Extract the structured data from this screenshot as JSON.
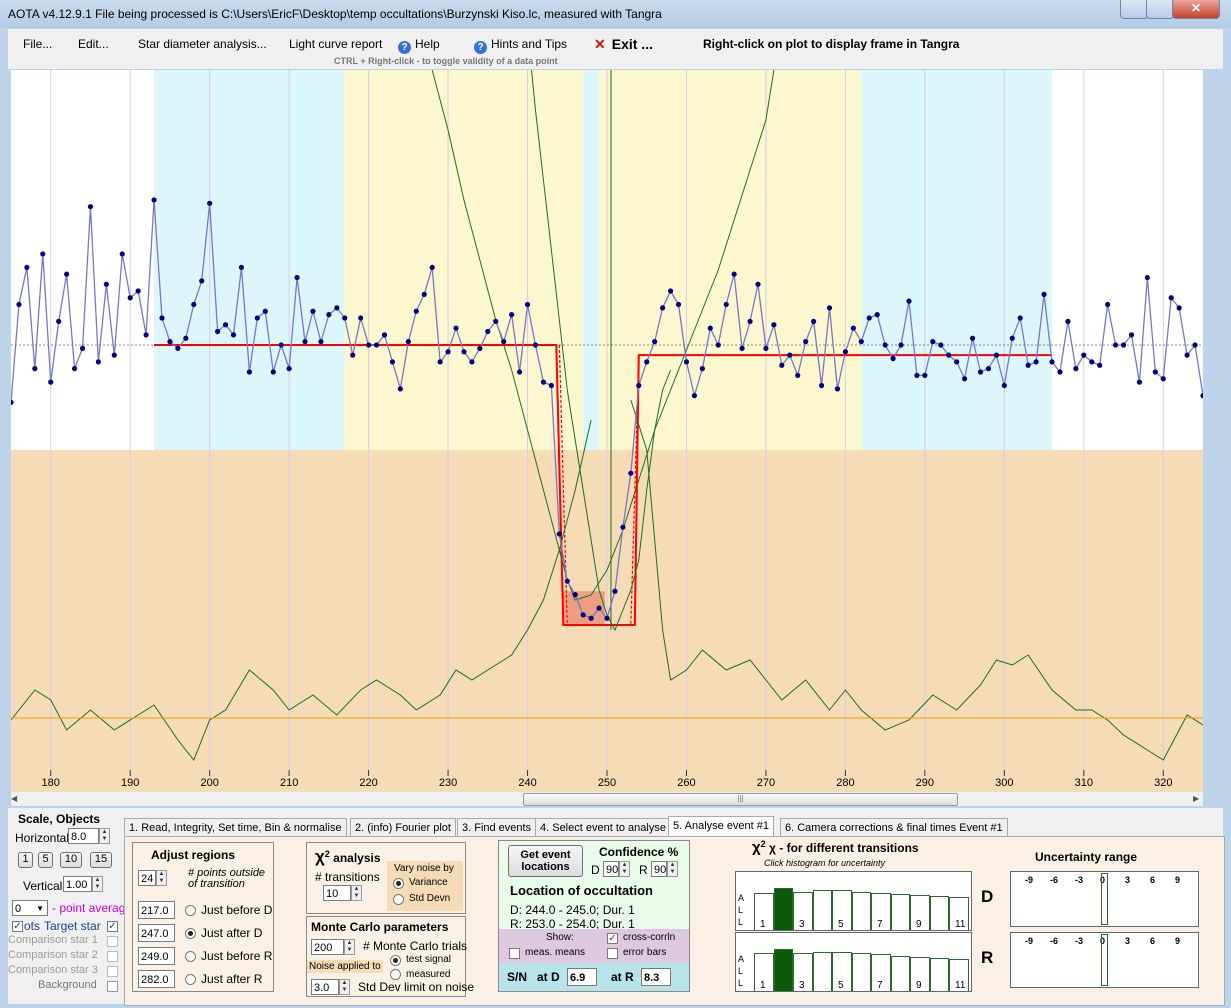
{
  "window": {
    "title": "AOTA v4.12.9.1    File being processed is C:\\Users\\EricF\\Desktop\\temp occultations\\Burzynski Kiso.lc, measured with Tangra"
  },
  "menu": {
    "file": "File...",
    "edit": "Edit...",
    "star_diam": "Star diameter analysis...",
    "light_curve": "Light curve report",
    "help": "Help",
    "hints": "Hints and Tips",
    "exit": "Exit ...",
    "right_click_note": "Right-click on plot to display frame in Tangra",
    "ctrl_note": "CTRL + Right-click  -  to toggle validity of a data point"
  },
  "chart_data": {
    "type": "line",
    "xlim": [
      175,
      325
    ],
    "x_ticks": [
      "180",
      "190",
      "200",
      "210",
      "220",
      "230",
      "240",
      "250",
      "260",
      "270",
      "280",
      "290",
      "300",
      "310",
      "320"
    ],
    "light_curve": {
      "x": [
        175,
        176,
        177,
        178,
        179,
        180,
        181,
        182,
        183,
        184,
        185,
        186,
        187,
        188,
        189,
        190,
        191,
        192,
        193,
        194,
        195,
        196,
        197,
        198,
        199,
        200,
        201,
        202,
        203,
        204,
        205,
        206,
        207,
        208,
        209,
        210,
        211,
        212,
        213,
        214,
        215,
        216,
        217,
        218,
        219,
        220,
        221,
        222,
        223,
        224,
        225,
        226,
        227,
        228,
        229,
        230,
        231,
        232,
        233,
        234,
        235,
        236,
        237,
        238,
        239,
        240,
        241,
        242,
        243,
        244,
        245,
        246,
        247,
        248,
        249,
        250,
        251,
        252,
        253,
        254,
        255,
        256,
        257,
        258,
        259,
        260,
        261,
        262,
        263,
        264,
        265,
        266,
        267,
        268,
        269,
        270,
        271,
        272,
        273,
        274,
        275,
        276,
        277,
        278,
        279,
        280,
        281,
        282,
        283,
        284,
        285,
        286,
        287,
        288,
        289,
        290,
        291,
        292,
        293,
        294,
        295,
        296,
        297,
        298,
        299,
        300,
        301,
        302,
        303,
        304,
        305,
        306,
        307,
        308,
        309,
        310,
        311,
        312,
        313,
        314,
        315,
        316,
        317,
        318,
        319,
        320,
        321,
        322,
        323,
        324,
        325
      ],
      "y": [
        0.96,
        1.25,
        1.36,
        1.06,
        1.4,
        1.02,
        1.2,
        1.34,
        1.06,
        1.12,
        1.54,
        1.08,
        1.31,
        1.1,
        1.4,
        1.27,
        1.29,
        1.16,
        1.56,
        1.21,
        1.14,
        1.12,
        1.15,
        1.25,
        1.32,
        1.55,
        1.17,
        1.19,
        1.16,
        1.36,
        1.05,
        1.21,
        1.23,
        1.05,
        1.13,
        1.06,
        1.33,
        1.14,
        1.23,
        1.14,
        1.22,
        1.24,
        1.21,
        1.1,
        1.21,
        1.13,
        1.13,
        1.16,
        1.08,
        1.0,
        1.14,
        1.23,
        1.28,
        1.36,
        1.08,
        1.11,
        1.18,
        1.11,
        1.08,
        1.12,
        1.17,
        1.2,
        1.14,
        1.22,
        1.05,
        1.25,
        1.13,
        1.02,
        1.01,
        0.57,
        0.43,
        0.39,
        0.33,
        0.32,
        0.35,
        0.32,
        0.4,
        0.59,
        0.75,
        1.01,
        1.08,
        1.14,
        1.24,
        1.29,
        1.25,
        1.08,
        0.98,
        1.06,
        1.18,
        1.13,
        1.25,
        1.34,
        1.12,
        1.2,
        1.31,
        1.12,
        1.19,
        1.07,
        1.1,
        1.04,
        1.14,
        1.2,
        1.01,
        1.24,
        1.0,
        1.11,
        1.18,
        1.14,
        1.21,
        1.22,
        1.13,
        1.09,
        1.13,
        1.26,
        1.04,
        1.04,
        1.14,
        1.13,
        1.1,
        1.08,
        1.03,
        1.15,
        1.05,
        1.06,
        1.1,
        1.01,
        1.15,
        1.21,
        1.07,
        1.08,
        1.28,
        1.08,
        1.05,
        1.2,
        1.06,
        1.1,
        1.08,
        1.07,
        1.25,
        1.13,
        1.13,
        1.16,
        1.02,
        1.33,
        1.05,
        1.03,
        1.27,
        1.24,
        1.1,
        1.13,
        0.98
      ]
    },
    "model_fit": {
      "normal_before": 1.13,
      "normal_after": 1.1,
      "event_bottom": 0.3,
      "d_start": 244,
      "d_end": 245,
      "r_start": 253,
      "r_end": 254,
      "fit_x_range": [
        193,
        306
      ]
    },
    "regions": {
      "baseline_before": [
        193,
        217
      ],
      "before_d": [
        217,
        247
      ],
      "after_d": [
        247,
        249
      ],
      "before_r": [
        249,
        282
      ],
      "after_r": [
        282,
        306
      ]
    }
  },
  "tabs": [
    "1. Read, Integrity, Set time, Bin & normalise",
    "2. (info)  Fourier plot",
    "3. Find events",
    "4. Select event to analyse",
    "5. Analyse event #1",
    "6. Camera corrections & final times Event #1"
  ],
  "side": {
    "title": "Scale,  Objects",
    "horizontal_label": "Horizontal",
    "horizontal_value": "8.0",
    "scale_buttons": [
      "1",
      "5",
      "10",
      "15"
    ],
    "vertical_label": "Vertical",
    "vertical_value": "1.00",
    "point_average_value": "0",
    "point_average_label": "- point average",
    "target_star": "Target star",
    "ts_prefix": "ots",
    "comparison": [
      "Comparison star 1",
      "Comparison star 2",
      "Comparison star 3"
    ],
    "background": "Background"
  },
  "adjust": {
    "title": "Adjust regions",
    "points_value": "24",
    "points_label": "# points outside of transition",
    "rows": [
      {
        "value": "217.0",
        "label": "Just before D",
        "checked": false
      },
      {
        "value": "247.0",
        "label": "Just after D",
        "checked": true
      },
      {
        "value": "249.0",
        "label": "Just before R",
        "checked": false
      },
      {
        "value": "282.0",
        "label": "Just after R",
        "checked": false
      }
    ]
  },
  "chi": {
    "title": "χ  analysis",
    "transitions_label": "# transitions",
    "transitions_value": "10",
    "vary_label": "Vary noise by",
    "variance": "Variance",
    "std_devn": "Std Devn"
  },
  "monte": {
    "title": "Monte Carlo parameters",
    "trials_value": "200",
    "trials_label": "# Monte Carlo trials",
    "noise_applied": "Noise applied to",
    "test_signal": "test signal",
    "measured": "measured",
    "limit_value": "3.0",
    "limit_label": "Std Dev limit on noise"
  },
  "loc": {
    "get_event": "Get event locations",
    "confidence": "Confidence %",
    "d_label": "D",
    "d_value": "90",
    "r_label": "R",
    "r_value": "90",
    "title": "Location of occultation",
    "d_line": "D: 244.0 - 245.0; Dur. 1",
    "r_line": "R: 253.0 - 254.0; Dur. 1",
    "show": "Show:",
    "cross_corr": "cross-corrln",
    "meas_means": "meas. means",
    "error_bars": "error bars",
    "sn_label": "S/N",
    "at_d": "at D",
    "at_d_value": "6.9",
    "at_r": "at R",
    "at_r_value": "8.3"
  },
  "histo": {
    "title": "χ  - for different transitions",
    "subtitle": "Click histogram for uncertainty",
    "side_letters": [
      "A",
      "L",
      "L"
    ],
    "labels": [
      "1",
      "3",
      "5",
      "7",
      "9",
      "11"
    ],
    "d_values": [
      0.9,
      1.0,
      0.92,
      0.97,
      0.96,
      0.93,
      0.91,
      0.88,
      0.86,
      0.84,
      0.82
    ],
    "r_values": [
      0.92,
      1.0,
      0.93,
      0.95,
      0.94,
      0.93,
      0.9,
      0.87,
      0.85,
      0.83,
      0.81
    ],
    "selected": 2,
    "d_letter": "D",
    "r_letter": "R"
  },
  "uncert": {
    "title": "Uncertainty range",
    "ticks": [
      "-9",
      "-6",
      "-3",
      "0",
      "3",
      "6",
      "9"
    ]
  },
  "colors": {
    "blue_region": "#dcf7fb",
    "yellow_region": "#fdf7cf",
    "tan": "#f5dbb6",
    "model": "#ff0000",
    "data": "#7777c8",
    "points": "#000080",
    "green": "#1e6e1e",
    "orange": "#f0a000"
  }
}
